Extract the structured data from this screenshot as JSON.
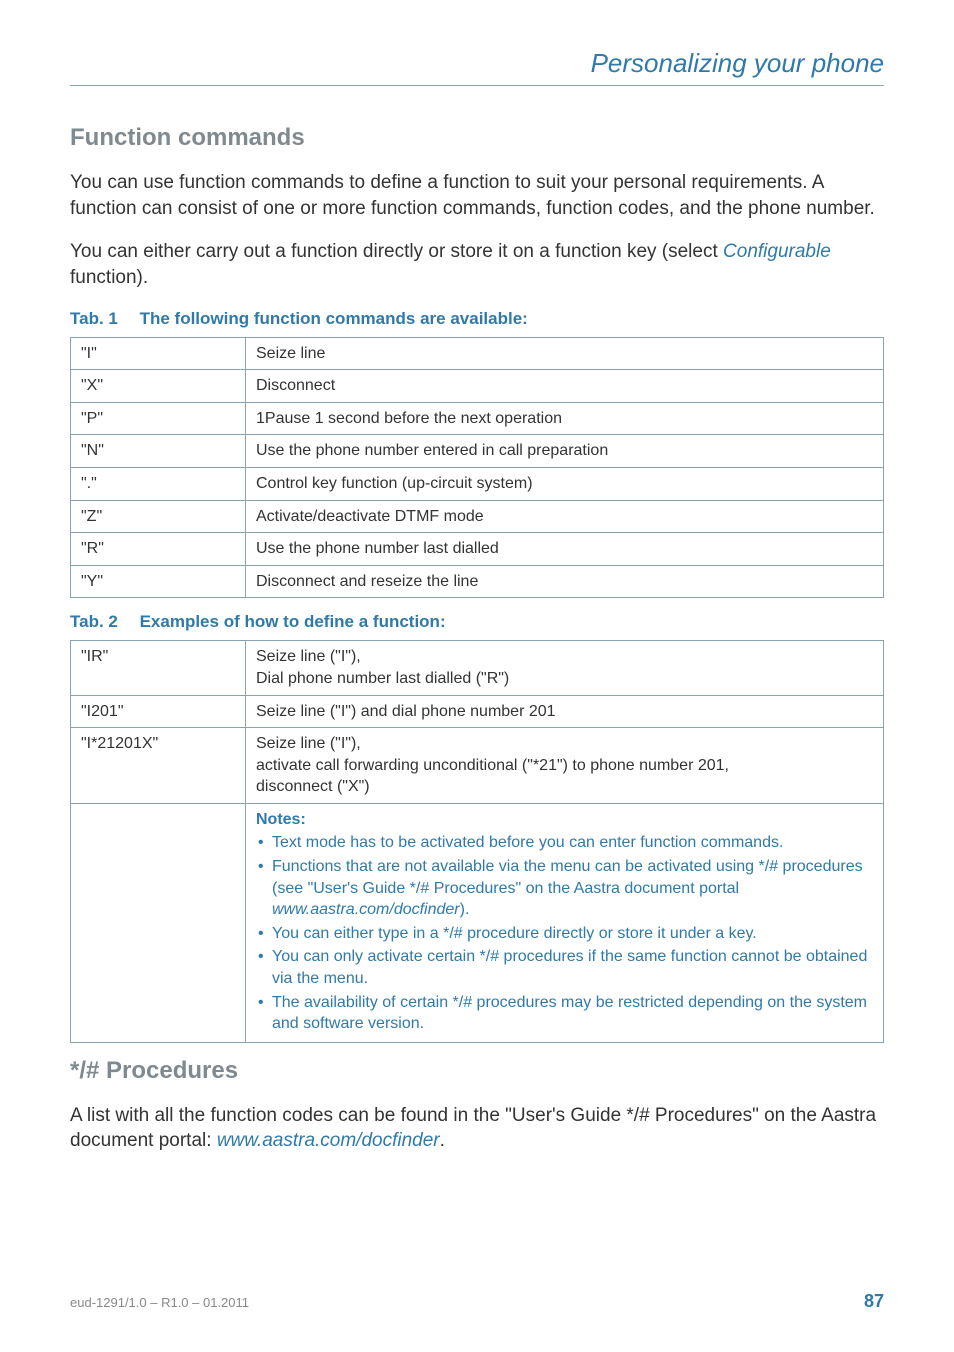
{
  "header": {
    "title": "Personalizing your phone"
  },
  "section1": {
    "heading": "Function commands",
    "p1": "You can use function commands to define a function to suit your personal requirements. A function can consist of one or more function commands, function codes, and the phone number.",
    "p2_a": "You can either carry out a function directly or store it on a function key (select ",
    "p2_cfg": "Configurable",
    "p2_b": " function)."
  },
  "tab1": {
    "caption": "Tab. 1  The following function commands are available:",
    "rows": [
      {
        "c": "\"I\"",
        "d": "Seize line"
      },
      {
        "c": "\"X\"",
        "d": "Disconnect"
      },
      {
        "c": "\"P\"",
        "d": "1Pause 1 second before the next operation"
      },
      {
        "c": "\"N\"",
        "d": "Use the phone number entered in call preparation"
      },
      {
        "c": "\".\"",
        "d": "Control key function (up-circuit system)"
      },
      {
        "c": "\"Z\"",
        "d": "Activate/deactivate DTMF mode"
      },
      {
        "c": "\"R\"",
        "d": "Use the phone number last dialled"
      },
      {
        "c": "\"Y\"",
        "d": "Disconnect and reseize the line"
      }
    ]
  },
  "tab2": {
    "caption": "Tab. 2  Examples of how to define a function:",
    "rows": [
      {
        "c": "\"IR\"",
        "d": "Seize line (\"I\"),\nDial phone number last dialled (\"R\")"
      },
      {
        "c": "\"I201\"",
        "d": "Seize line (\"I\") and dial phone number 201"
      },
      {
        "c": "\"I*21201X\"",
        "d": "Seize line (\"I\"),\nactivate call forwarding unconditional (\"*21\") to phone number 201,\ndisconnect (\"X\")"
      }
    ],
    "notes_title": "Notes:",
    "notes": [
      "Text mode has to be activated before you can enter function commands.",
      "Functions that are not available via the menu can be activated using */# procedures (see \"User's Guide */# Procedures\" on the Aastra document portal www.aastra.com/docfinder).",
      "You can either type in a */# procedure directly or store it under a key.",
      "You can only activate certain */# procedures if the same function cannot be obtained via the menu.",
      "The availability of certain */# procedures may be restricted depending on the system and software version."
    ],
    "note2_pre": "Functions that are not available via the menu can be activated using */# procedures (see \"User's Guide */# Procedures\" on the Aastra document portal ",
    "note2_link": "www.aastra.com/docfinder",
    "note2_post": ")."
  },
  "section2": {
    "heading": "*/# Procedures",
    "p_a": "A list with all the function codes can be found in the \"User's Guide */# Procedures\" on the Aastra document portal: ",
    "p_link": "www.aastra.com/docfinder",
    "p_b": "."
  },
  "footer": {
    "docid": "eud-1291/1.0 – R1.0 – 01.2011",
    "page": "87"
  }
}
